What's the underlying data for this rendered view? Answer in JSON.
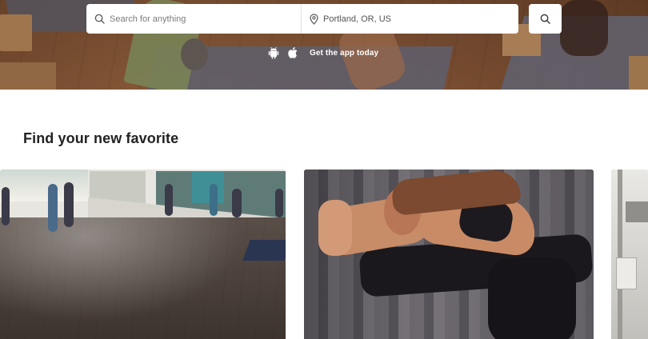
{
  "search": {
    "what_placeholder": "Search for anything",
    "where_value": "Portland, OR, US"
  },
  "app_banner": {
    "text": "Get the app today",
    "icons": [
      "android-icon",
      "apple-icon"
    ]
  },
  "section": {
    "title": "Find your new favorite"
  },
  "cards": [
    {
      "image": "yoga-studio-class-photo"
    },
    {
      "image": "woman-stretching-photo"
    },
    {
      "image": "studio-interior-photo"
    }
  ],
  "colors": {
    "background": "#ffffff",
    "search_bg": "#ffffff",
    "title_text": "#222222"
  }
}
